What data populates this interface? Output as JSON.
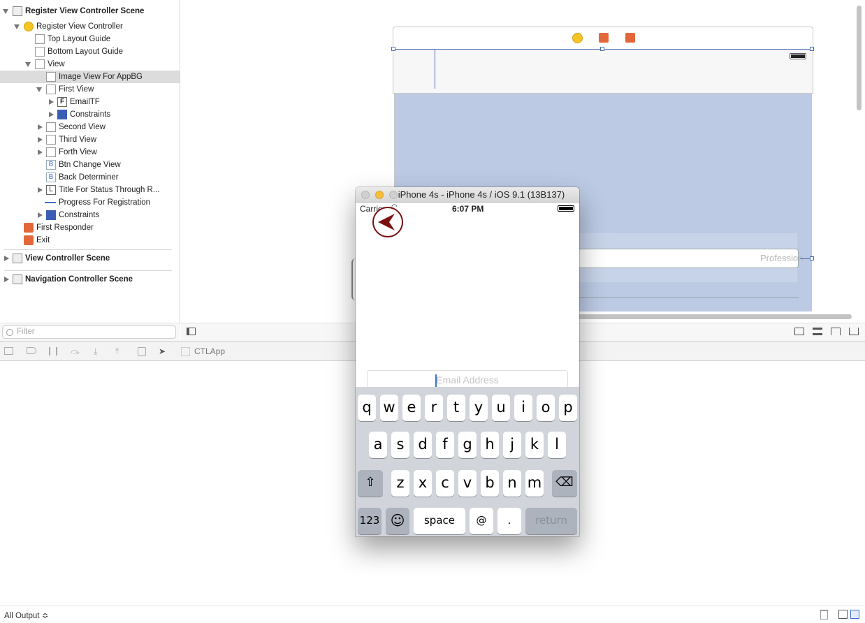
{
  "outline": {
    "items": [
      {
        "label": "Register View Controller Scene",
        "bold": true
      },
      {
        "label": "Register View Controller"
      },
      {
        "label": "Top Layout Guide"
      },
      {
        "label": "Bottom Layout Guide"
      },
      {
        "label": "View"
      },
      {
        "label": "Image View For AppBG",
        "selected": true
      },
      {
        "label": "First View"
      },
      {
        "label": "EmailTF",
        "icon_text": "F"
      },
      {
        "label": "Constraints"
      },
      {
        "label": "Second View"
      },
      {
        "label": "Third View"
      },
      {
        "label": "Forth View"
      },
      {
        "label": "Btn Change View",
        "icon_text": "B"
      },
      {
        "label": "Back Determiner",
        "icon_text": "B"
      },
      {
        "label": "Title For Status Through R...",
        "icon_text": "L"
      },
      {
        "label": "Progress For Registration"
      },
      {
        "label": "Constraints"
      },
      {
        "label": "First Responder"
      },
      {
        "label": "Exit"
      },
      {
        "label": "View Controller Scene",
        "bold": true
      },
      {
        "label": "Navigation Controller Scene",
        "bold": true
      }
    ],
    "filter_placeholder": "Filter"
  },
  "canvas": {
    "profession_placeholder": "Profession"
  },
  "debug": {
    "target_label": "CTLApp",
    "output_selector": "All Output ≎"
  },
  "simulator": {
    "title": "iPhone 4s - iPhone 4s / iOS 9.1 (13B137)",
    "carrier": "Carrier",
    "time": "6:07 PM",
    "email_placeholder": "Email Address",
    "keyboard": {
      "row1": [
        "q",
        "w",
        "e",
        "r",
        "t",
        "y",
        "u",
        "i",
        "o",
        "p"
      ],
      "row2": [
        "a",
        "s",
        "d",
        "f",
        "g",
        "h",
        "j",
        "k",
        "l"
      ],
      "row3": [
        "z",
        "x",
        "c",
        "v",
        "b",
        "n",
        "m"
      ],
      "numbers_label": "123",
      "space_label": "space",
      "at_label": "@",
      "dot_label": ".",
      "return_label": "return"
    }
  },
  "colors": {
    "canvas_view_bg": "#bccae4",
    "back_button": "#7a1010",
    "keyboard_bg": "#d1d5db",
    "selection": "#dcdcdc"
  }
}
